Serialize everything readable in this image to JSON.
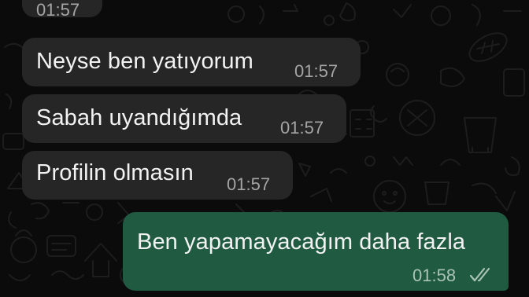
{
  "chat": {
    "background_color": "#0b0b0b",
    "incoming_bubble_color": "#262626",
    "outgoing_bubble_color": "#1f5a41",
    "messages": [
      {
        "direction": "incoming",
        "text": "",
        "time": "01:57",
        "partially_visible": true
      },
      {
        "direction": "incoming",
        "text": "Neyse ben yatıyorum",
        "time": "01:57"
      },
      {
        "direction": "incoming",
        "text": "Sabah uyandığımda",
        "time": "01:57"
      },
      {
        "direction": "incoming",
        "text": "Profilin olmasın",
        "time": "01:57"
      },
      {
        "direction": "outgoing",
        "text": "Ben yapamayacağım daha fazla",
        "time": "01:58",
        "status_icon": "double-check-icon",
        "status": "delivered"
      }
    ]
  }
}
